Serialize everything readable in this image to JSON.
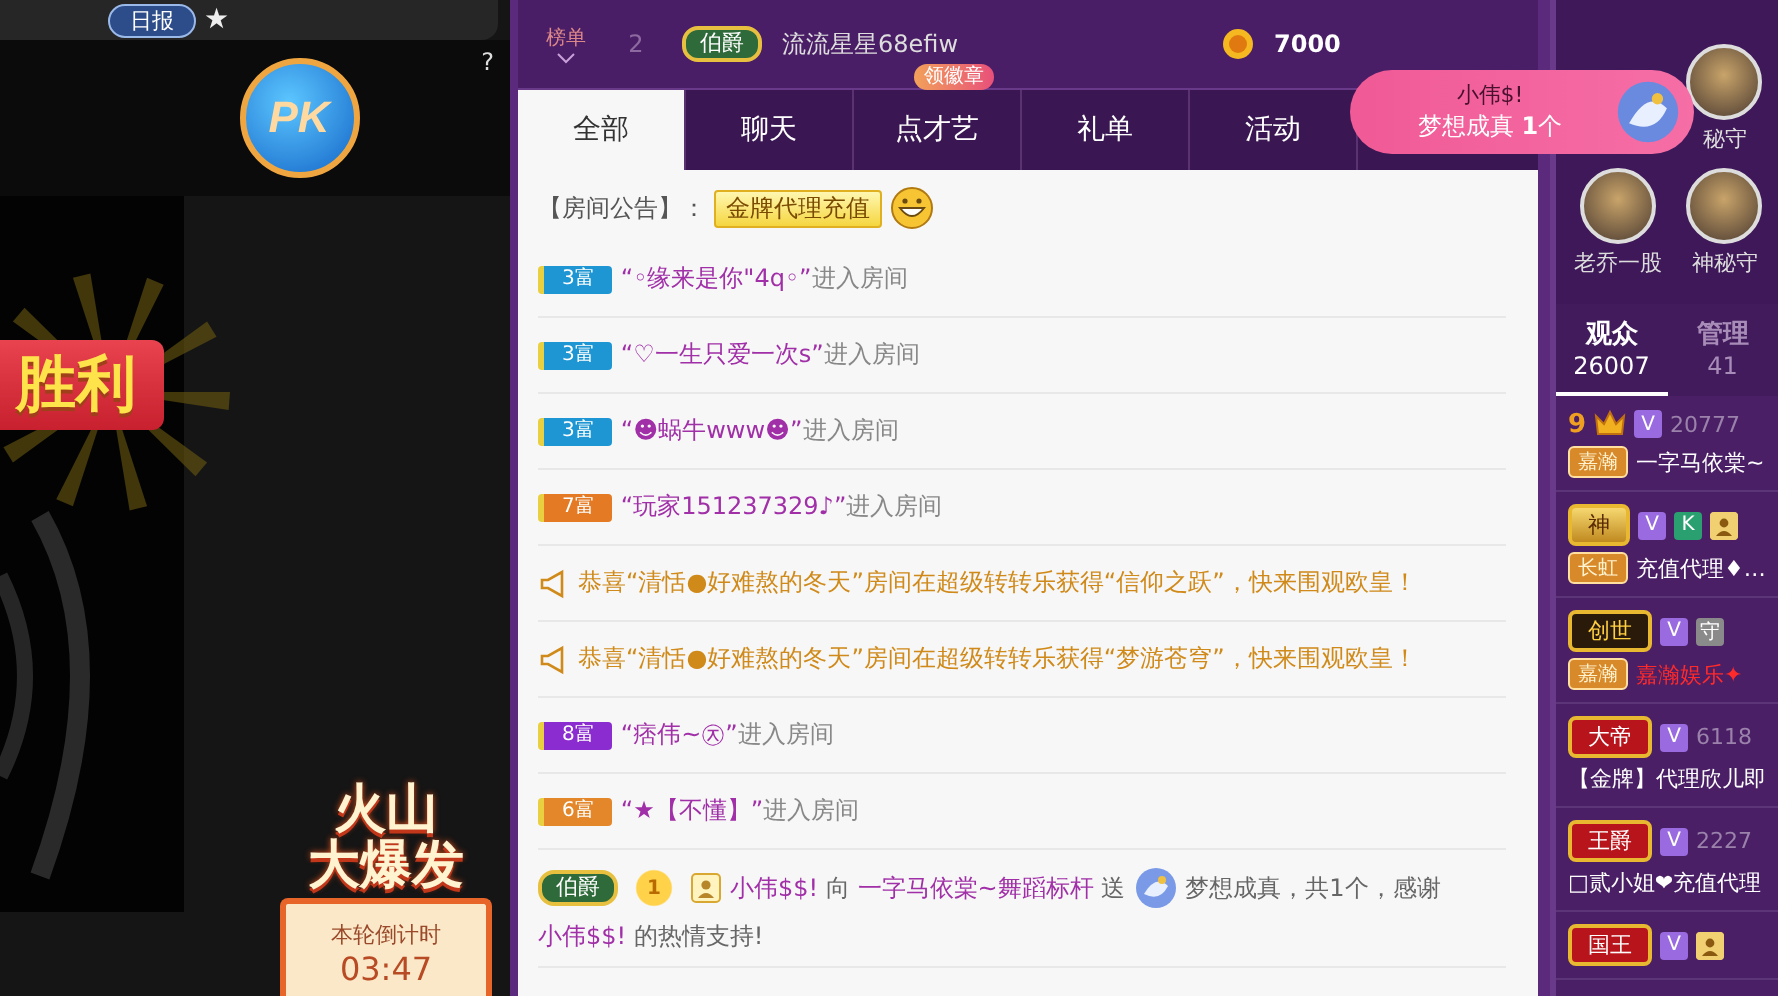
{
  "left": {
    "daily_badge": "日报",
    "star": "★",
    "pk": "PK",
    "help": "?",
    "victory": "胜利",
    "event": {
      "title_1": "火山",
      "title_2": "大爆发",
      "countdown_label": "本轮倒计时",
      "countdown": "03:47"
    }
  },
  "rank": {
    "label": "榜单",
    "rows": [
      {
        "rank": "2",
        "badge": "伯爵",
        "name": "流流星星68efiw",
        "coins": "7000"
      }
    ]
  },
  "tabs": [
    {
      "label": "全部",
      "selected": true
    },
    {
      "label": "聊天",
      "selected": false
    },
    {
      "label": "点才艺",
      "selected": false,
      "badge": "领徽章"
    },
    {
      "label": "礼单",
      "selected": false
    },
    {
      "label": "活动",
      "selected": false
    }
  ],
  "messages": [
    {
      "kind": "notice",
      "label": "【房间公告】：",
      "tag": "金牌代理充值"
    },
    {
      "kind": "enter",
      "badge": "3富",
      "color": "#1e96d4",
      "name": "“◦缘来是你\"4q◦”",
      "action": "进入房间"
    },
    {
      "kind": "enter",
      "badge": "3富",
      "color": "#1e96d4",
      "name": "“♡一生只爱一次s”",
      "action": "进入房间"
    },
    {
      "kind": "enter",
      "badge": "3富",
      "color": "#1e96d4",
      "name": "“☻蜗牛www☻”",
      "action": "进入房间"
    },
    {
      "kind": "enter",
      "badge": "7富",
      "color": "#e47a24",
      "name": "“玩家151237329♪”",
      "action": "进入房间"
    },
    {
      "kind": "broadcast",
      "text": "恭喜“清恬●好难熬的冬天”房间在超级转转乐获得“信仰之跃”，快来围观欧皇！"
    },
    {
      "kind": "broadcast",
      "text": "恭喜“清恬●好难熬的冬天”房间在超级转转乐获得“梦游苍穹”，快来围观欧皇！"
    },
    {
      "kind": "enter",
      "badge": "8富",
      "color": "#8a2ccf",
      "name": "“痞伟~㉨”",
      "action": "进入房间"
    },
    {
      "kind": "enter",
      "badge": "6富",
      "color": "#e4872a",
      "name": "“★【不懂】”",
      "action": "进入房间"
    },
    {
      "kind": "gift",
      "badge": "伯爵",
      "level": "1",
      "sender": "小伟$$!",
      "to": "向",
      "receiver": "一字马依棠~舞蹈标杆",
      "send": "送",
      "gift": "梦想成真，共1个，感谢",
      "thanked": "小伟$$!",
      "closing": "的热情支持!"
    }
  ],
  "toast": {
    "user": "小伟$!",
    "text": "梦想成真 **1**个"
  },
  "guards": [
    {
      "name": "秘守"
    },
    {
      "name": "老乔一股"
    },
    {
      "name": "神秘守"
    }
  ],
  "audience_tabs": [
    {
      "label": "观众",
      "count": "26007",
      "selected": true
    },
    {
      "label": "管理",
      "count": "41",
      "selected": false
    }
  ],
  "audience": [
    {
      "title": {
        "kind": "number",
        "text": "9"
      },
      "chips": [
        {
          "kind": "vip",
          "text": "V"
        }
      ],
      "score": "20777",
      "tag": "嘉瀚",
      "name": "一字马依棠~",
      "highlight": false
    },
    {
      "title": {
        "kind": "gold",
        "text": "神"
      },
      "chips": [
        {
          "kind": "vip",
          "text": "V"
        },
        {
          "kind": "letter",
          "text": "K"
        },
        {
          "kind": "user"
        }
      ],
      "tag": "长虹",
      "name": "充值代理♦…",
      "highlight": false
    },
    {
      "title": {
        "kind": "dark",
        "text": "创世"
      },
      "chips": [
        {
          "kind": "vip",
          "text": "V"
        },
        {
          "kind": "guard",
          "text": "守"
        }
      ],
      "tag": "嘉瀚",
      "name": "嘉瀚娱乐✦",
      "highlight": true
    },
    {
      "title": {
        "kind": "red",
        "text": "大帝"
      },
      "chips": [
        {
          "kind": "vip",
          "text": "V"
        }
      ],
      "score": "6118",
      "name": "【金牌】代理欣儿即",
      "highlight": false
    },
    {
      "title": {
        "kind": "red",
        "text": "王爵"
      },
      "chips": [
        {
          "kind": "vip",
          "text": "V"
        }
      ],
      "score": "2227",
      "name": "□贰小姐❤充值代理",
      "highlight": false
    },
    {
      "title": {
        "kind": "red",
        "text": "国王"
      },
      "chips": [
        {
          "kind": "vip",
          "text": "V"
        },
        {
          "kind": "user"
        }
      ]
    }
  ]
}
